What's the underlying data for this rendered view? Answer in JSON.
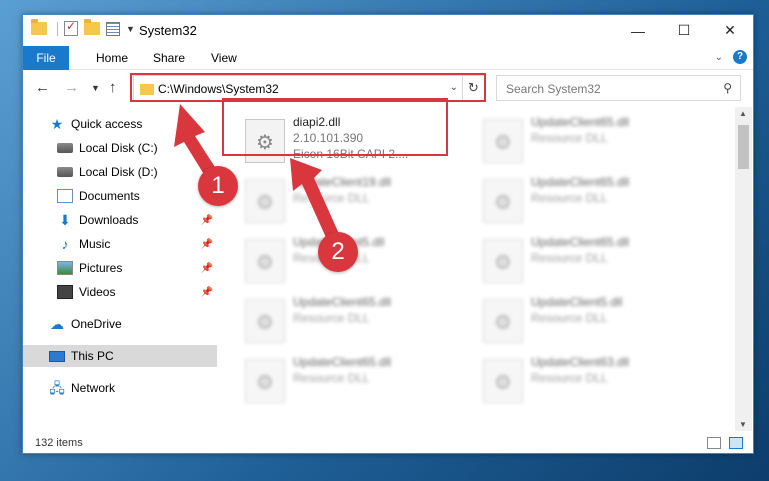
{
  "window": {
    "title": "System32",
    "controls": {
      "minimize": "—",
      "maximize": "☐",
      "close": "✕"
    }
  },
  "ribbon": {
    "tabs": [
      "File",
      "Home",
      "Share",
      "View"
    ]
  },
  "navigation": {
    "address": "C:\\Windows\\System32",
    "search_placeholder": "Search System32"
  },
  "sidebar": {
    "items": [
      {
        "label": "Quick access",
        "icon": "star-icon",
        "pinned": false
      },
      {
        "label": "Local Disk (C:)",
        "icon": "disk-icon",
        "pinned": false
      },
      {
        "label": "Local Disk (D:)",
        "icon": "disk-icon",
        "pinned": false
      },
      {
        "label": "Documents",
        "icon": "document-icon",
        "pinned": false
      },
      {
        "label": "Downloads",
        "icon": "download-icon",
        "pinned": true
      },
      {
        "label": "Music",
        "icon": "music-icon",
        "pinned": true
      },
      {
        "label": "Pictures",
        "icon": "picture-icon",
        "pinned": true
      },
      {
        "label": "Videos",
        "icon": "video-icon",
        "pinned": true
      },
      {
        "label": "OneDrive",
        "icon": "cloud-icon",
        "pinned": false
      },
      {
        "label": "This PC",
        "icon": "computer-icon",
        "pinned": false,
        "selected": true
      },
      {
        "label": "Network",
        "icon": "network-icon",
        "pinned": false
      }
    ]
  },
  "files": [
    {
      "name": "diapi2.dll",
      "line2": "2.10.101.390",
      "line3": "Eicon 16Bit CAPI 2....",
      "blurred": false
    },
    {
      "name": "UpdateClient65.dll",
      "line2": "Resource DLL",
      "blurred": true
    },
    {
      "name": "UpdateClient19.dll",
      "line2": "Resource DLL",
      "blurred": true
    },
    {
      "name": "UpdateClient65.dll",
      "line2": "Resource DLL",
      "blurred": true
    },
    {
      "name": "UpdateClient5.dll",
      "line2": "Resource DLL",
      "blurred": true
    },
    {
      "name": "UpdateClient65.dll",
      "line2": "Resource DLL",
      "blurred": true
    },
    {
      "name": "UpdateClient65.dll",
      "line2": "Resource DLL",
      "blurred": true
    },
    {
      "name": "UpdateClient5.dll",
      "line2": "Resource DLL",
      "blurred": true
    },
    {
      "name": "UpdateClient65.dll",
      "line2": "Resource DLL",
      "blurred": true
    },
    {
      "name": "UpdateClient63.dll",
      "line2": "Resource DLL",
      "blurred": true
    }
  ],
  "status": {
    "item_count": "132 items"
  },
  "annotations": {
    "badge1": "1",
    "badge2": "2",
    "color": "#d9363e"
  }
}
